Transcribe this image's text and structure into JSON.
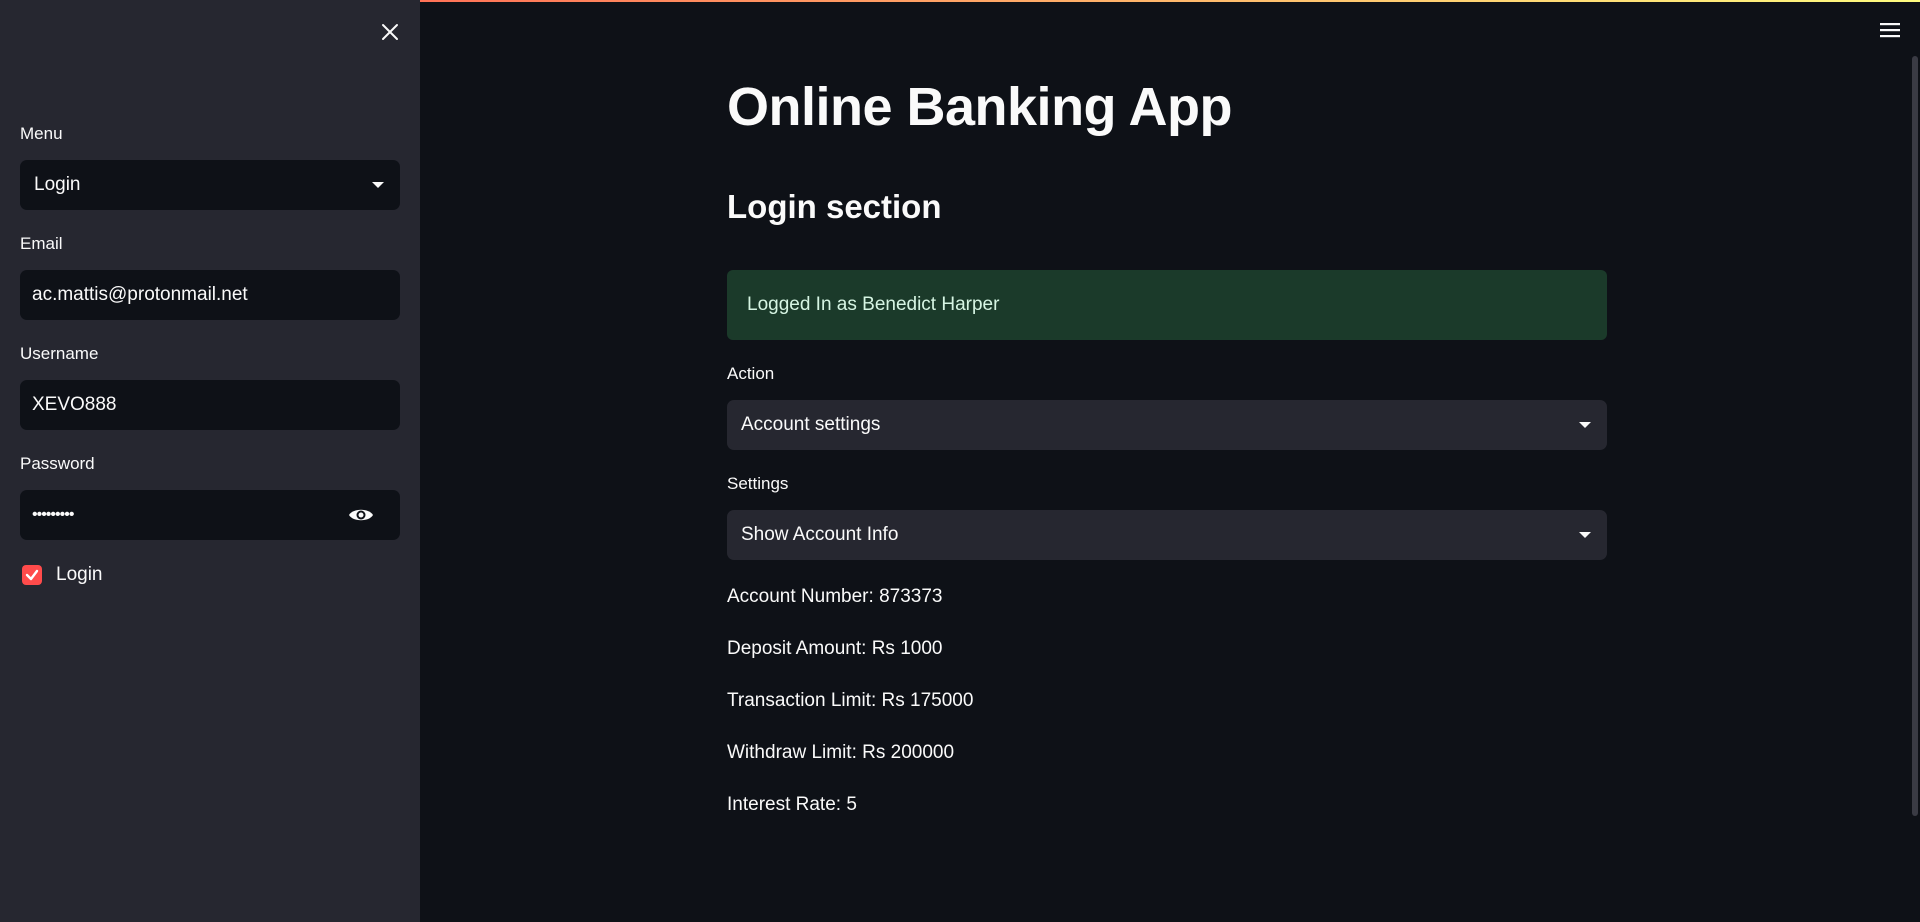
{
  "colors": {
    "background": "#0e1117",
    "sidebar": "#262730",
    "accent": "#ff4b4b",
    "success_bg": "#1b3a2a"
  },
  "sidebar": {
    "close_icon": "close-icon",
    "menu": {
      "label": "Menu",
      "value": "Login"
    },
    "email": {
      "label": "Email",
      "value": "ac.mattis@protonmail.net"
    },
    "username": {
      "label": "Username",
      "value": "XEVO888"
    },
    "password": {
      "label": "Password",
      "value": "•••••••••",
      "toggle_icon": "eye-icon"
    },
    "login_checkbox": {
      "label": "Login",
      "checked": true
    }
  },
  "header": {
    "menu_icon": "hamburger-menu-icon"
  },
  "main": {
    "title": "Online Banking App",
    "section_title": "Login section",
    "success_message": "Logged In as Benedict Harper",
    "action": {
      "label": "Action",
      "value": "Account settings"
    },
    "settings": {
      "label": "Settings",
      "value": "Show Account Info"
    },
    "account_info": [
      "Account Number: 873373",
      "Deposit Amount: Rs 1000",
      "Transaction Limit: Rs 175000",
      "Withdraw Limit: Rs 200000",
      "Interest Rate: 5"
    ]
  }
}
